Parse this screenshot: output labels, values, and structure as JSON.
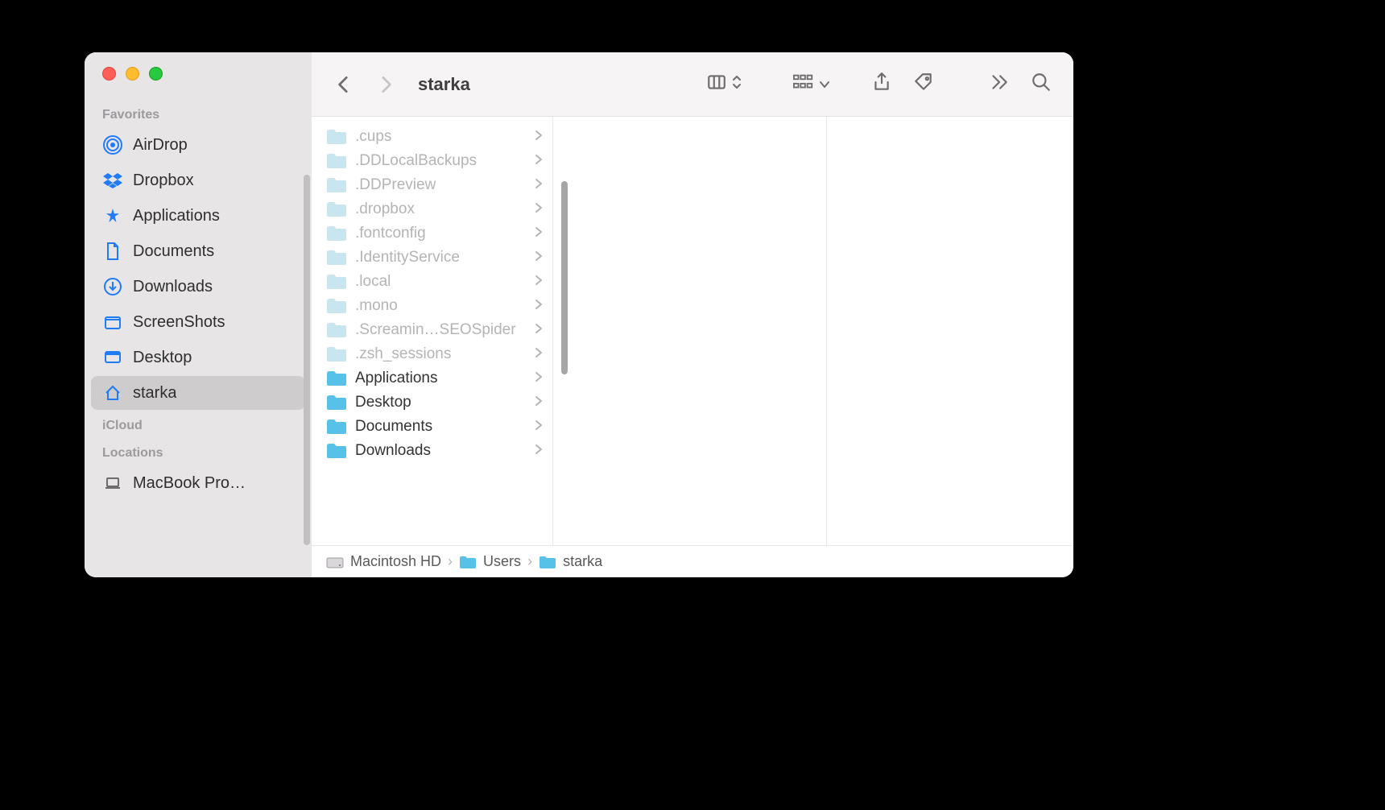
{
  "window_title": "starka",
  "sidebar": {
    "sections": [
      {
        "title": "Favorites",
        "items": [
          {
            "label": "AirDrop",
            "icon": "airdrop",
            "selected": false
          },
          {
            "label": "Dropbox",
            "icon": "dropbox",
            "selected": false
          },
          {
            "label": "Applications",
            "icon": "app",
            "selected": false
          },
          {
            "label": "Documents",
            "icon": "document",
            "selected": false
          },
          {
            "label": "Downloads",
            "icon": "download",
            "selected": false
          },
          {
            "label": "ScreenShots",
            "icon": "folder",
            "selected": false
          },
          {
            "label": "Desktop",
            "icon": "desktop",
            "selected": false
          },
          {
            "label": "starka",
            "icon": "home",
            "selected": true
          }
        ]
      },
      {
        "title": "iCloud",
        "items": []
      },
      {
        "title": "Locations",
        "items": [
          {
            "label": "MacBook Pro…",
            "icon": "laptop",
            "selected": false
          }
        ]
      }
    ]
  },
  "column": {
    "items": [
      {
        "name": ".cups",
        "hidden": true
      },
      {
        "name": ".DDLocalBackups",
        "hidden": true
      },
      {
        "name": ".DDPreview",
        "hidden": true
      },
      {
        "name": ".dropbox",
        "hidden": true
      },
      {
        "name": ".fontconfig",
        "hidden": true
      },
      {
        "name": ".IdentityService",
        "hidden": true
      },
      {
        "name": ".local",
        "hidden": true
      },
      {
        "name": ".mono",
        "hidden": true
      },
      {
        "name": ".Screamin…SEOSpider",
        "hidden": true
      },
      {
        "name": ".zsh_sessions",
        "hidden": true
      },
      {
        "name": "Applications",
        "hidden": false
      },
      {
        "name": "Desktop",
        "hidden": false
      },
      {
        "name": "Documents",
        "hidden": false
      },
      {
        "name": "Downloads",
        "hidden": false
      }
    ]
  },
  "pathbar": [
    {
      "label": "Macintosh HD",
      "icon": "hdd"
    },
    {
      "label": "Users",
      "icon": "folder-sm"
    },
    {
      "label": "starka",
      "icon": "folder-sm"
    }
  ]
}
